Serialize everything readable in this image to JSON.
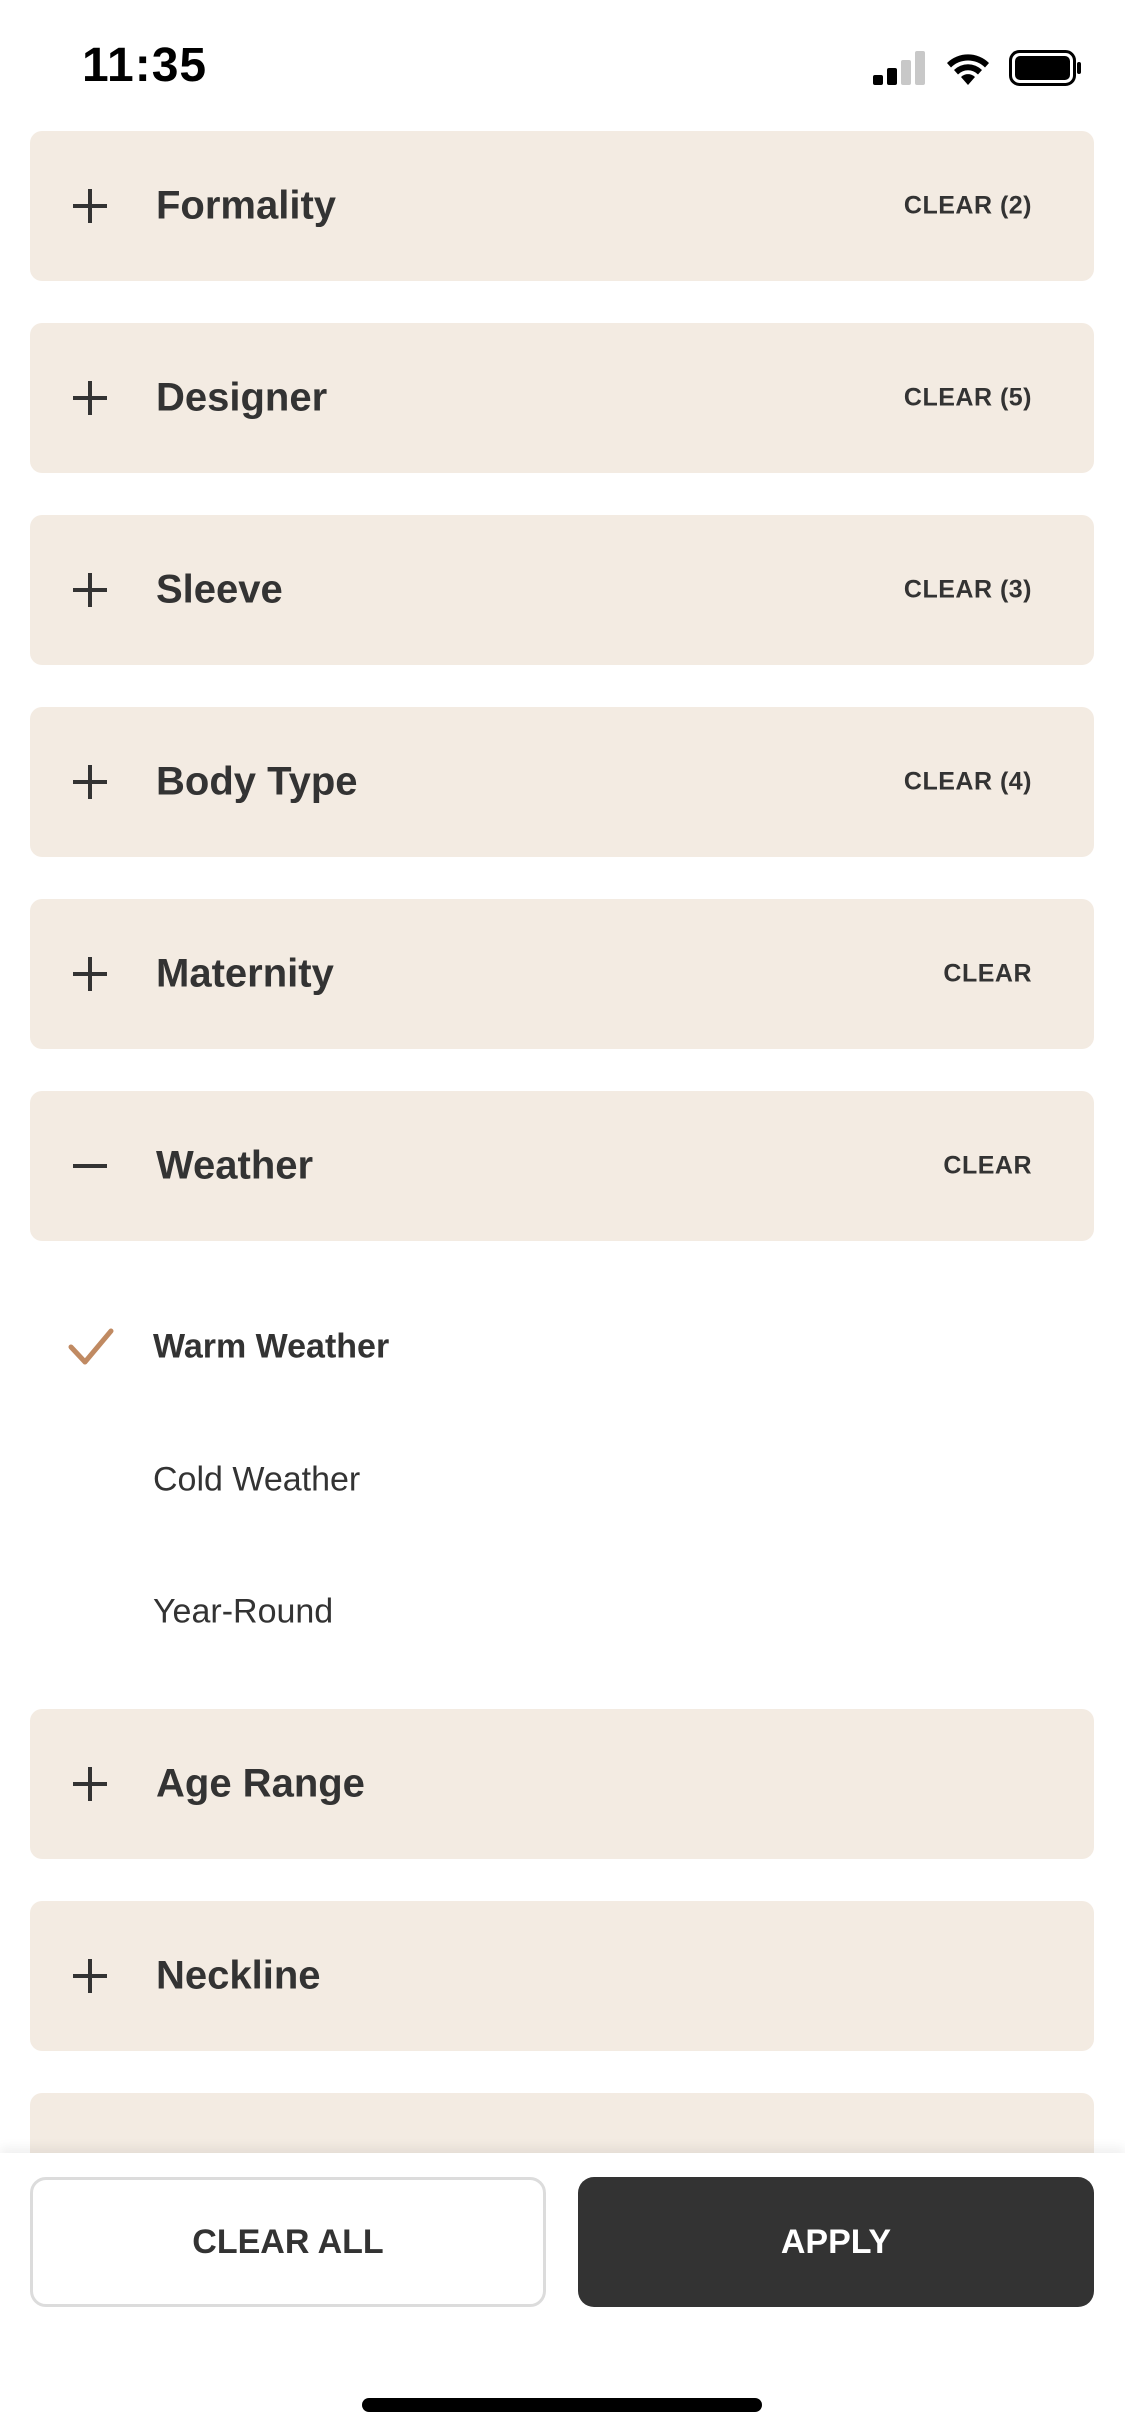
{
  "status_bar": {
    "time": "11:35"
  },
  "filters": [
    {
      "title": "Formality",
      "clear_label": "CLEAR (2)",
      "expanded": false
    },
    {
      "title": "Designer",
      "clear_label": "CLEAR (5)",
      "expanded": false
    },
    {
      "title": "Sleeve",
      "clear_label": "CLEAR (3)",
      "expanded": false
    },
    {
      "title": "Body Type",
      "clear_label": "CLEAR (4)",
      "expanded": false
    },
    {
      "title": "Maternity",
      "clear_label": "CLEAR",
      "expanded": false
    },
    {
      "title": "Weather",
      "clear_label": "CLEAR",
      "expanded": true
    },
    {
      "title": "Age Range",
      "clear_label": "",
      "expanded": false
    },
    {
      "title": "Neckline",
      "clear_label": "",
      "expanded": false
    }
  ],
  "weather_options": [
    {
      "label": "Warm Weather",
      "selected": true
    },
    {
      "label": "Cold Weather",
      "selected": false
    },
    {
      "label": "Year-Round",
      "selected": false
    }
  ],
  "footer": {
    "clear_all_label": "CLEAR ALL",
    "apply_label": "APPLY"
  },
  "colors": {
    "row_background": "#f3ebe2",
    "check_accent": "#c08a62",
    "apply_background": "#333333"
  }
}
